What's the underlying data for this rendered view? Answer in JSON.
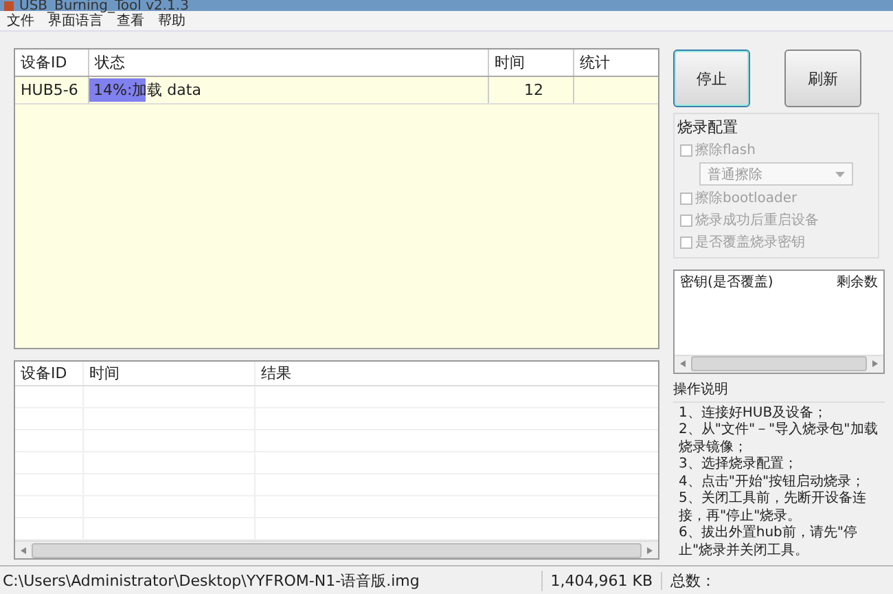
{
  "window": {
    "title": "USB_Burning_Tool v2.1.3"
  },
  "menu": [
    "文件",
    "界面语言",
    "查看",
    "帮助"
  ],
  "device_table": {
    "columns": [
      "设备ID",
      "状态",
      "时间",
      "统计"
    ],
    "rows": [
      {
        "device_id": "HUB5-6",
        "status": "14%:加载 data",
        "level": 0.14,
        "time": "12",
        "stats": ""
      }
    ]
  },
  "log_table": {
    "columns": [
      "设备ID",
      "时间",
      "结果"
    ]
  },
  "buttons": [
    {
      "label": "停止",
      "focused": true
    },
    {
      "label": "刷新",
      "focused": false
    }
  ],
  "config": {
    "title": "烧录配置",
    "options": [
      {
        "kind": "checkbox",
        "label": "擦除flash",
        "checked": false,
        "disabled": true
      },
      {
        "kind": "dropdown",
        "label": "普通擦除",
        "disabled": true
      },
      {
        "kind": "checkbox",
        "label": "擦除bootloader",
        "checked": false,
        "disabled": true
      },
      {
        "kind": "checkbox",
        "label": "烧录成功后重启设备",
        "checked": false,
        "disabled": true
      },
      {
        "kind": "checkbox",
        "label": "是否覆盖烧录密钥",
        "checked": false,
        "disabled": true
      }
    ]
  },
  "key_table": {
    "columns": [
      "密钥(是否覆盖)",
      "剩余数"
    ]
  },
  "instructions": {
    "title": "操作说明",
    "lines": [
      "1、连接好HUB及设备；",
      "2、从\"文件\"－\"导入烧录包\"加载烧录镜像；",
      "3、选择烧录配置；",
      "4、点击\"开始\"按钮启动烧录；",
      "5、关闭工具前，先断开设备连接，再\"停止\"烧录。",
      "6、拔出外置hub前，请先\"停止\"烧录并关闭工具。"
    ]
  },
  "status_bar": {
    "path": "C:\\Users\\Administrator\\Desktop\\YYFROM-N1-语音版.img",
    "size": "1,404,961 KB",
    "total_label": "总数："
  }
}
